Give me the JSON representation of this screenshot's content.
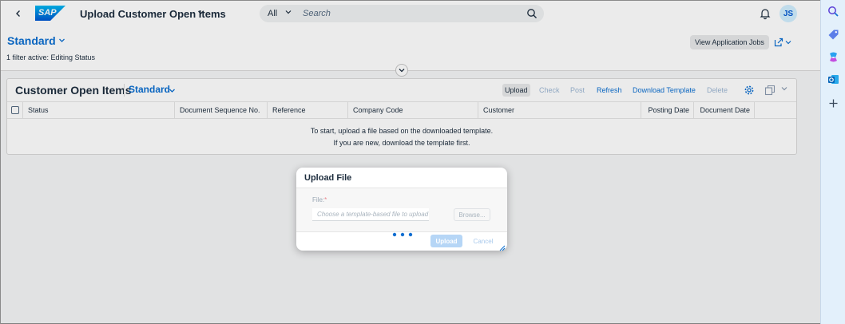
{
  "shell": {
    "brand": "SAP",
    "app_title": "Upload Customer Open Items",
    "search_scope": "All",
    "search_placeholder": "Search",
    "avatar_initials": "JS"
  },
  "header": {
    "variant": "Standard",
    "filter_status": "1 filter active: Editing Status",
    "view_jobs_label": "View Application Jobs"
  },
  "table": {
    "title": "Customer Open Items",
    "variant": "Standard",
    "toolbar": {
      "upload": "Upload",
      "check": "Check",
      "post": "Post",
      "refresh": "Refresh",
      "download_template": "Download Template",
      "delete": "Delete"
    },
    "columns": [
      "Status",
      "Document Sequence No.",
      "Reference",
      "Company Code",
      "Customer",
      "Posting Date",
      "Document Date"
    ],
    "empty_line1": "To start, upload a file based on the downloaded template.",
    "empty_line2": "If you are new, download the template first."
  },
  "dialog": {
    "title": "Upload File",
    "file_label": "File:",
    "required_mark": "*",
    "file_placeholder": "Choose a template-based file to upload",
    "browse_label": "Browse...",
    "upload_label": "Upload",
    "cancel_label": "Cancel"
  },
  "colors": {
    "brand_blue": "#0a6ed1",
    "shell_bg": "#ffffff",
    "side_pane_bg": "#e3f0fb"
  },
  "icons": [
    "back-icon",
    "chevron-down-icon",
    "search-icon",
    "bell-icon",
    "share-icon",
    "settings-icon",
    "export-icon",
    "busy-indicator-icon",
    "resize-handle-icon"
  ]
}
